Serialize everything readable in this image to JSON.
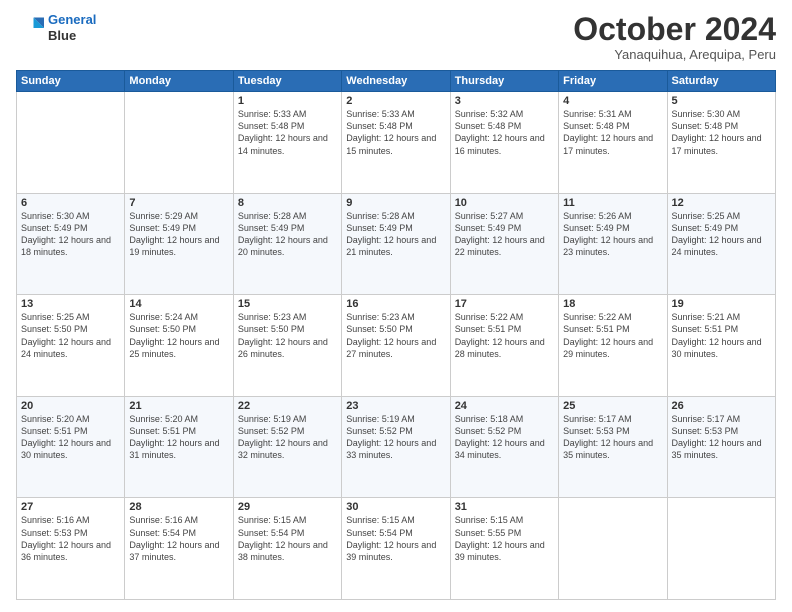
{
  "logo": {
    "line1": "General",
    "line2": "Blue"
  },
  "header": {
    "month": "October 2024",
    "location": "Yanaquihua, Arequipa, Peru"
  },
  "weekdays": [
    "Sunday",
    "Monday",
    "Tuesday",
    "Wednesday",
    "Thursday",
    "Friday",
    "Saturday"
  ],
  "weeks": [
    [
      {
        "day": "",
        "info": ""
      },
      {
        "day": "",
        "info": ""
      },
      {
        "day": "1",
        "info": "Sunrise: 5:33 AM\nSunset: 5:48 PM\nDaylight: 12 hours\nand 14 minutes."
      },
      {
        "day": "2",
        "info": "Sunrise: 5:33 AM\nSunset: 5:48 PM\nDaylight: 12 hours\nand 15 minutes."
      },
      {
        "day": "3",
        "info": "Sunrise: 5:32 AM\nSunset: 5:48 PM\nDaylight: 12 hours\nand 16 minutes."
      },
      {
        "day": "4",
        "info": "Sunrise: 5:31 AM\nSunset: 5:48 PM\nDaylight: 12 hours\nand 17 minutes."
      },
      {
        "day": "5",
        "info": "Sunrise: 5:30 AM\nSunset: 5:48 PM\nDaylight: 12 hours\nand 17 minutes."
      }
    ],
    [
      {
        "day": "6",
        "info": "Sunrise: 5:30 AM\nSunset: 5:49 PM\nDaylight: 12 hours\nand 18 minutes."
      },
      {
        "day": "7",
        "info": "Sunrise: 5:29 AM\nSunset: 5:49 PM\nDaylight: 12 hours\nand 19 minutes."
      },
      {
        "day": "8",
        "info": "Sunrise: 5:28 AM\nSunset: 5:49 PM\nDaylight: 12 hours\nand 20 minutes."
      },
      {
        "day": "9",
        "info": "Sunrise: 5:28 AM\nSunset: 5:49 PM\nDaylight: 12 hours\nand 21 minutes."
      },
      {
        "day": "10",
        "info": "Sunrise: 5:27 AM\nSunset: 5:49 PM\nDaylight: 12 hours\nand 22 minutes."
      },
      {
        "day": "11",
        "info": "Sunrise: 5:26 AM\nSunset: 5:49 PM\nDaylight: 12 hours\nand 23 minutes."
      },
      {
        "day": "12",
        "info": "Sunrise: 5:25 AM\nSunset: 5:49 PM\nDaylight: 12 hours\nand 24 minutes."
      }
    ],
    [
      {
        "day": "13",
        "info": "Sunrise: 5:25 AM\nSunset: 5:50 PM\nDaylight: 12 hours\nand 24 minutes."
      },
      {
        "day": "14",
        "info": "Sunrise: 5:24 AM\nSunset: 5:50 PM\nDaylight: 12 hours\nand 25 minutes."
      },
      {
        "day": "15",
        "info": "Sunrise: 5:23 AM\nSunset: 5:50 PM\nDaylight: 12 hours\nand 26 minutes."
      },
      {
        "day": "16",
        "info": "Sunrise: 5:23 AM\nSunset: 5:50 PM\nDaylight: 12 hours\nand 27 minutes."
      },
      {
        "day": "17",
        "info": "Sunrise: 5:22 AM\nSunset: 5:51 PM\nDaylight: 12 hours\nand 28 minutes."
      },
      {
        "day": "18",
        "info": "Sunrise: 5:22 AM\nSunset: 5:51 PM\nDaylight: 12 hours\nand 29 minutes."
      },
      {
        "day": "19",
        "info": "Sunrise: 5:21 AM\nSunset: 5:51 PM\nDaylight: 12 hours\nand 30 minutes."
      }
    ],
    [
      {
        "day": "20",
        "info": "Sunrise: 5:20 AM\nSunset: 5:51 PM\nDaylight: 12 hours\nand 30 minutes."
      },
      {
        "day": "21",
        "info": "Sunrise: 5:20 AM\nSunset: 5:51 PM\nDaylight: 12 hours\nand 31 minutes."
      },
      {
        "day": "22",
        "info": "Sunrise: 5:19 AM\nSunset: 5:52 PM\nDaylight: 12 hours\nand 32 minutes."
      },
      {
        "day": "23",
        "info": "Sunrise: 5:19 AM\nSunset: 5:52 PM\nDaylight: 12 hours\nand 33 minutes."
      },
      {
        "day": "24",
        "info": "Sunrise: 5:18 AM\nSunset: 5:52 PM\nDaylight: 12 hours\nand 34 minutes."
      },
      {
        "day": "25",
        "info": "Sunrise: 5:17 AM\nSunset: 5:53 PM\nDaylight: 12 hours\nand 35 minutes."
      },
      {
        "day": "26",
        "info": "Sunrise: 5:17 AM\nSunset: 5:53 PM\nDaylight: 12 hours\nand 35 minutes."
      }
    ],
    [
      {
        "day": "27",
        "info": "Sunrise: 5:16 AM\nSunset: 5:53 PM\nDaylight: 12 hours\nand 36 minutes."
      },
      {
        "day": "28",
        "info": "Sunrise: 5:16 AM\nSunset: 5:54 PM\nDaylight: 12 hours\nand 37 minutes."
      },
      {
        "day": "29",
        "info": "Sunrise: 5:15 AM\nSunset: 5:54 PM\nDaylight: 12 hours\nand 38 minutes."
      },
      {
        "day": "30",
        "info": "Sunrise: 5:15 AM\nSunset: 5:54 PM\nDaylight: 12 hours\nand 39 minutes."
      },
      {
        "day": "31",
        "info": "Sunrise: 5:15 AM\nSunset: 5:55 PM\nDaylight: 12 hours\nand 39 minutes."
      },
      {
        "day": "",
        "info": ""
      },
      {
        "day": "",
        "info": ""
      }
    ]
  ]
}
